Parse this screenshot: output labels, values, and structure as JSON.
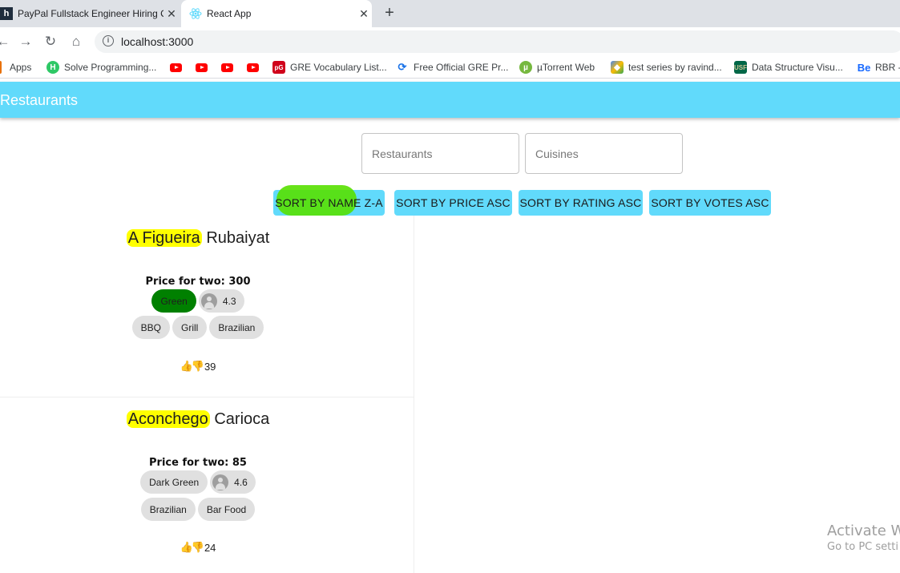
{
  "browser": {
    "tabs": [
      {
        "title": "PayPal Fullstack Engineer Hiring C",
        "favicon": "h",
        "active": false
      },
      {
        "title": "React App",
        "favicon": "react-icon",
        "active": true
      }
    ],
    "new_tab": "+",
    "url": "localhost:3000",
    "bookmarks": [
      {
        "label": "Apps",
        "icon": "apps-grid-icon"
      },
      {
        "label": "Solve Programming...",
        "icon": "hackerrank-icon"
      },
      {
        "label": "",
        "icon": "youtube-icon"
      },
      {
        "label": "",
        "icon": "youtube-icon"
      },
      {
        "label": "",
        "icon": "youtube-icon"
      },
      {
        "label": "",
        "icon": "youtube-icon"
      },
      {
        "label": "GRE Vocabulary List...",
        "icon": "vocab-icon"
      },
      {
        "label": "Free Official GRE Pr...",
        "icon": "ets-icon"
      },
      {
        "label": "µTorrent Web",
        "icon": "utorrent-icon"
      },
      {
        "label": "test series by ravind...",
        "icon": "drive-icon"
      },
      {
        "label": "Data Structure Visu...",
        "icon": "usf-icon"
      },
      {
        "label": "RBR -",
        "icon": "behance-icon"
      }
    ]
  },
  "app": {
    "title": "Restaurants",
    "search": {
      "restaurants_placeholder": "Restaurants",
      "cuisines_placeholder": "Cuisines"
    },
    "sort_buttons": [
      "SORT BY NAME Z-A",
      "SORT BY PRICE ASC",
      "SORT BY RATING ASC",
      "SORT BY VOTES ASC"
    ],
    "restaurants": [
      {
        "name_highlight": "A Figueira",
        "name_rest": " Rubaiyat",
        "price": "Price for two: 300",
        "rating_text": "Green",
        "rating_color": "#008000",
        "rating": "4.3",
        "cuisines": [
          "BBQ",
          "Grill",
          "Brazilian"
        ],
        "votes": "39"
      },
      {
        "name_highlight": "Aconchego",
        "name_rest": " Carioca",
        "price": "Price for two: 85",
        "rating_text": "Dark Green",
        "rating_color": "#e0e0e0",
        "rating": "4.6",
        "cuisines": [
          "Brazilian",
          "Bar Food"
        ],
        "votes": "24"
      }
    ]
  },
  "os_watermark": {
    "line1": "Activate W",
    "line2": "Go to PC setti"
  }
}
